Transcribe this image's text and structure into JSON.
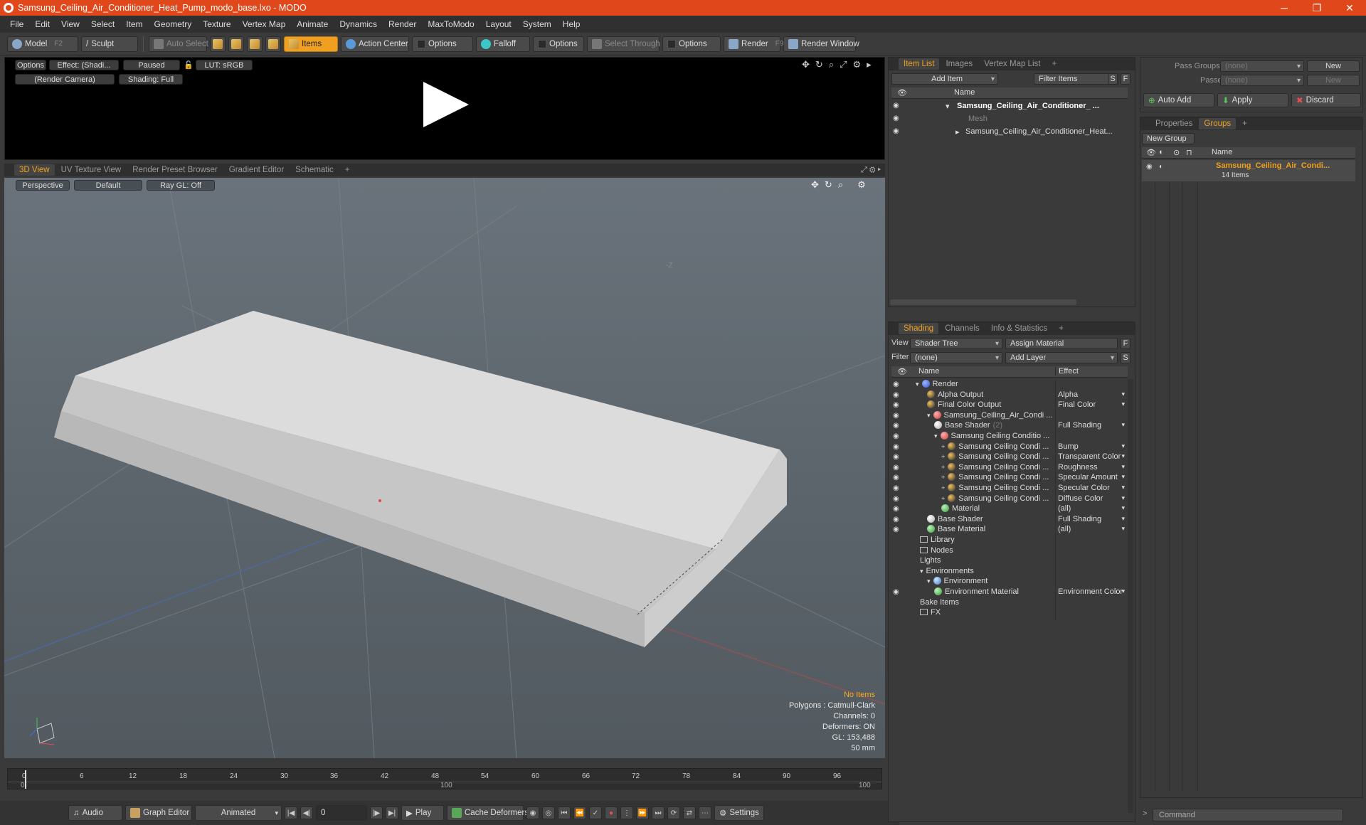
{
  "window": {
    "title": "Samsung_Ceiling_Air_Conditioner_Heat_Pump_modo_base.lxo - MODO"
  },
  "menu": [
    "File",
    "Edit",
    "View",
    "Select",
    "Item",
    "Geometry",
    "Texture",
    "Vertex Map",
    "Animate",
    "Dynamics",
    "Render",
    "MaxToModo",
    "Layout",
    "System",
    "Help"
  ],
  "toolbar": {
    "model": "Model",
    "model_key": "F2",
    "sculpt": "Sculpt",
    "auto_select": "Auto Select",
    "items": "Items",
    "action_center": "Action Center",
    "options1": "Options",
    "falloff": "Falloff",
    "options2": "Options",
    "select_through": "Select Through",
    "options3": "Options",
    "render": "Render",
    "render_key": "F9",
    "render_window": "Render Window"
  },
  "preview": {
    "options": "Options",
    "effect": "Effect: (Shadi...",
    "paused": "Paused",
    "lut": "LUT: sRGB",
    "camera": "(Render Camera)",
    "shading": "Shading: Full"
  },
  "view_tabs": [
    "3D View",
    "UV Texture View",
    "Render Preset Browser",
    "Gradient Editor",
    "Schematic",
    "+"
  ],
  "viewport": {
    "projection": "Perspective",
    "style": "Default",
    "raygl": "Ray GL: Off"
  },
  "stats": {
    "items": "No Items",
    "polygons": "Polygons : Catmull-Clark",
    "channels": "Channels: 0",
    "deformers": "Deformers: ON",
    "gl": "GL: 153,488",
    "focal": "50 mm"
  },
  "timeline": {
    "ticks": [
      "0",
      "6",
      "12",
      "18",
      "24",
      "30",
      "36",
      "42",
      "48",
      "54",
      "60",
      "66",
      "72",
      "78",
      "84",
      "90",
      "96"
    ],
    "lower": [
      "0",
      "100",
      "100"
    ]
  },
  "transport": {
    "audio": "Audio",
    "graph_editor": "Graph Editor",
    "animated": "Animated",
    "frame": "0",
    "play": "Play",
    "cache": "Cache Deformers",
    "settings": "Settings"
  },
  "itemlist": {
    "tabs": [
      "Item List",
      "Images",
      "Vertex Map List",
      "+"
    ],
    "add_item": "Add Item",
    "filter": "Filter Items",
    "s": "S",
    "f": "F",
    "col_name": "Name",
    "rows": [
      "Samsung_Ceiling_Air_Conditioner_ ...",
      "Mesh",
      "Samsung_Ceiling_Air_Conditioner_Heat..."
    ]
  },
  "shading": {
    "tabs": [
      "Shading",
      "Channels",
      "Info & Statistics",
      "+"
    ],
    "view_label": "View",
    "view_value": "Shader Tree",
    "assign": "Assign Material",
    "f": "F",
    "filter_label": "Filter",
    "filter_value": "(none)",
    "add_layer": "Add Layer",
    "s": "S",
    "col_name": "Name",
    "col_effect": "Effect",
    "rows": [
      {
        "name": "Render",
        "effect": ""
      },
      {
        "name": "Alpha Output",
        "effect": "Alpha"
      },
      {
        "name": "Final Color Output",
        "effect": "Final Color"
      },
      {
        "name": "Samsung_Ceiling_Air_Condi ...",
        "effect": ""
      },
      {
        "name": "Base Shader",
        "count": "(2)",
        "effect": "Full Shading"
      },
      {
        "name": "Samsung Ceiling Conditio ...",
        "effect": ""
      },
      {
        "name": "Samsung Ceiling Condi ...",
        "effect": "Bump"
      },
      {
        "name": "Samsung Ceiling Condi ...",
        "effect": "Transparent Color"
      },
      {
        "name": "Samsung Ceiling Condi ...",
        "effect": "Roughness"
      },
      {
        "name": "Samsung Ceiling Condi ...",
        "effect": "Specular Amount"
      },
      {
        "name": "Samsung Ceiling Condi ...",
        "effect": "Specular Color"
      },
      {
        "name": "Samsung Ceiling Condi ...",
        "effect": "Diffuse Color"
      },
      {
        "name": "Material",
        "effect": "(all)"
      },
      {
        "name": "Base Shader",
        "effect": "Full Shading"
      },
      {
        "name": "Base Material",
        "effect": "(all)"
      },
      {
        "name": "Library",
        "effect": ""
      },
      {
        "name": "Nodes",
        "effect": ""
      },
      {
        "name": "Lights",
        "effect": ""
      },
      {
        "name": "Environments",
        "effect": ""
      },
      {
        "name": "Environment",
        "effect": ""
      },
      {
        "name": "Environment Material",
        "effect": "Environment Color"
      },
      {
        "name": "Bake Items",
        "effect": ""
      },
      {
        "name": "FX",
        "effect": ""
      }
    ]
  },
  "passes": {
    "pass_groups": "Pass Groups",
    "passes": "Passes",
    "none": "(none)",
    "new": "New",
    "auto_add": "Auto Add",
    "apply": "Apply",
    "discard": "Discard"
  },
  "groups": {
    "tabs": [
      "Properties",
      "Groups",
      "+"
    ],
    "new_group": "New Group",
    "col_name": "Name",
    "group_name": "Samsung_Ceiling_Air_Condi...",
    "group_count": "14 Items"
  },
  "command": {
    "placeholder": "Command"
  }
}
